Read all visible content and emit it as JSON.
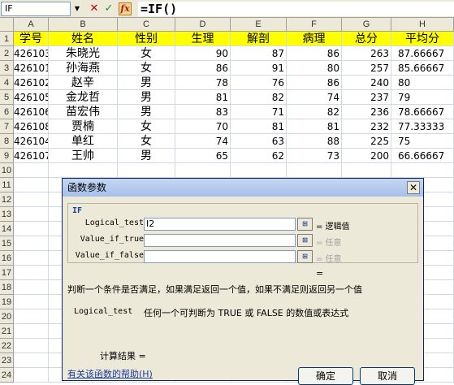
{
  "formula_bar": {
    "name_box": "IF",
    "cancel_glyph": "✕",
    "enter_glyph": "✓",
    "fx_label": "fx",
    "formula": "=IF()"
  },
  "columns": [
    "A",
    "B",
    "C",
    "D",
    "E",
    "F",
    "G",
    "H"
  ],
  "row_numbers": [
    "1",
    "2",
    "3",
    "4",
    "5",
    "6",
    "7",
    "8",
    "9",
    "10",
    "11",
    "12",
    "13",
    "14",
    "15",
    "16",
    "17",
    "18",
    "19",
    "20",
    "21",
    "22",
    "23",
    "24"
  ],
  "header_row": [
    "学号",
    "姓名",
    "性别",
    "生理",
    "解剖",
    "病理",
    "总分",
    "平均分"
  ],
  "rows": [
    [
      "426103",
      "朱晓光",
      "女",
      "90",
      "87",
      "86",
      "263",
      "87.66667"
    ],
    [
      "426101",
      "孙海燕",
      "女",
      "86",
      "91",
      "80",
      "257",
      "85.66667"
    ],
    [
      "426102",
      "赵辛",
      "男",
      "78",
      "76",
      "86",
      "240",
      "80"
    ],
    [
      "426105",
      "金龙哲",
      "男",
      "81",
      "82",
      "74",
      "237",
      "79"
    ],
    [
      "426106",
      "苗宏伟",
      "男",
      "83",
      "71",
      "82",
      "236",
      "78.66667"
    ],
    [
      "426108",
      "贾楠",
      "女",
      "70",
      "81",
      "81",
      "232",
      "77.33333"
    ],
    [
      "426104",
      "单红",
      "女",
      "74",
      "63",
      "88",
      "225",
      "75"
    ],
    [
      "426107",
      "王帅",
      "男",
      "65",
      "62",
      "73",
      "200",
      "66.66667"
    ]
  ],
  "dialog": {
    "title": "函数参数",
    "close_glyph": "✕",
    "function_name": "IF",
    "args": [
      {
        "label": "Logical_test",
        "value": "I2",
        "result": "= 逻辑值"
      },
      {
        "label": "Value_if_true",
        "value": "",
        "result": "= 任意"
      },
      {
        "label": "Value_if_false",
        "value": "",
        "result": "= 任意"
      }
    ],
    "range_btn_glyph": "⊞",
    "equals_line": "=",
    "description": "判断一个条件是否满足，如果满足返回一个值，如果不满足则返回另一个值",
    "arg_help_name": "Logical_test",
    "arg_help_text": "任何一个可判断为 TRUE 或 FALSE 的数值或表达式",
    "result_label": "计算结果 =",
    "help_link": "有关该函数的帮助(H)",
    "ok_label": "确定",
    "cancel_label": "取消"
  }
}
